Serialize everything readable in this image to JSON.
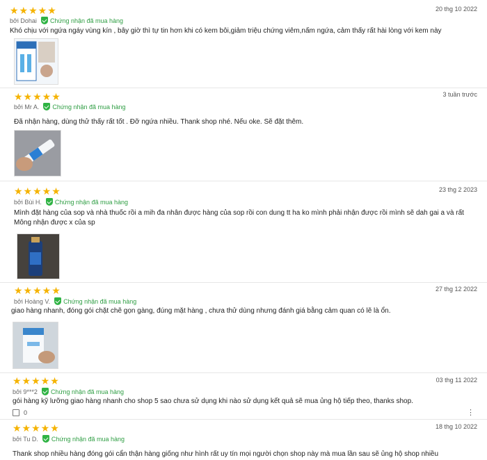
{
  "verified_label": "Chứng nhận đã mua hàng",
  "stars": "★★★★★",
  "colors": {
    "star": "#f5b301",
    "verified": "#2f9e44",
    "divider": "#e6e6e6"
  },
  "reviews": [
    {
      "author": "bởi Dohai",
      "date": "20 thg 10 2022",
      "rating": 5,
      "text": "Khó chịu với ngứa ngáy vùng kín , bây giờ thì tự tin hơn khi có kem bôi,giảm triệu chứng viêm,nấm ngứa, cảm thấy rất hài lòng với kem này"
    },
    {
      "author": "bởi Mr A.",
      "date": "3 tuần trước",
      "rating": 5,
      "text": "Đã nhận hàng, dùng thử thấy rất tốt . Đỡ ngứa nhiều. Thank shop nhé. Nếu oke. Sẽ đặt thêm."
    },
    {
      "author": "bởi Bùi H.",
      "date": "23 thg 2 2023",
      "rating": 5,
      "text": "Mình đặt hàng của sop và nhà thuốc rồi a mih đa nhân được hàng của sop rồi con dung tt ha ko mình phải nhận được rồi mình sẽ dah gai a và rất Mông nhận được x của sp"
    },
    {
      "author": "bởi Hoàng V.",
      "date": "27 thg 12 2022",
      "rating": 5,
      "text": "giao hàng nhanh, đóng gói chặt chẽ gọn gàng, đúng mặt hàng , chưa thử dùng nhưng đánh giá bằng cảm quan có lẽ là ổn."
    },
    {
      "author": "bởi 9***2",
      "date": "03 thg 11 2022",
      "rating": 5,
      "text": "gói hàng kỹ lưỡng giao hàng nhanh cho shop 5 sao chưa sử dụng khi nào sử dụng kết quả sẽ mua ủng hộ tiếp theo, thanks shop.",
      "likes": "0"
    },
    {
      "author": "bởi Tu D.",
      "date": "18 thg 10 2022",
      "rating": 5,
      "text": "Thank shop nhiều hàng đóng gói cẩn thận hàng giống như hình rất uy tín mọi người chọn shop này mà mua lần sau sẽ ủng hộ shop nhiều"
    }
  ]
}
